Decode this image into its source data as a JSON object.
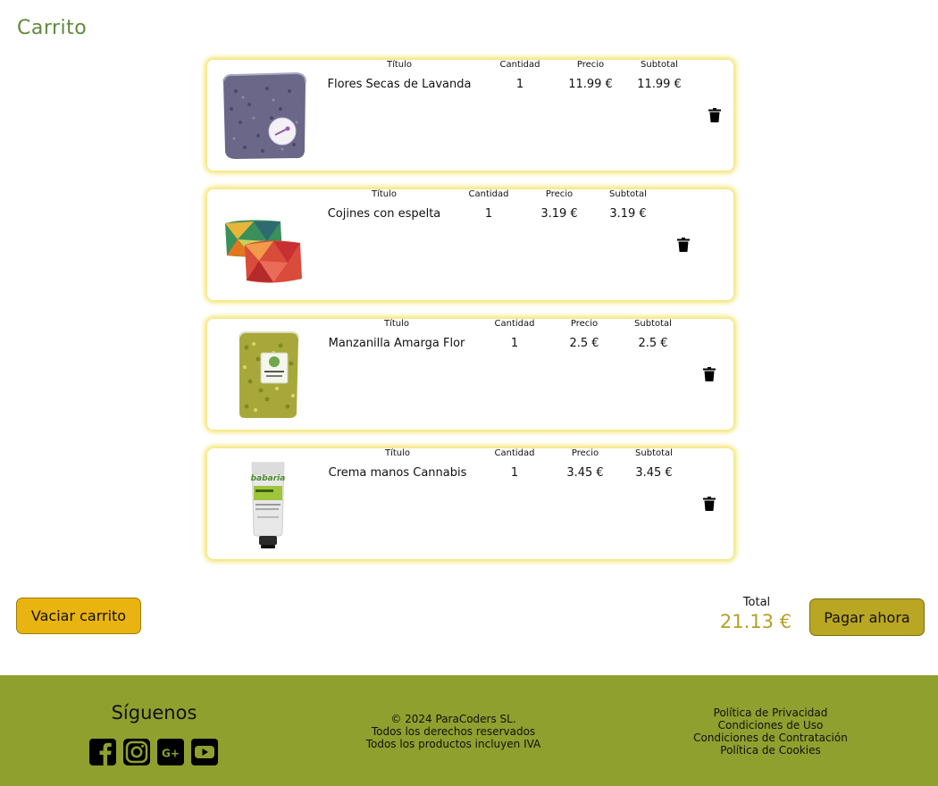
{
  "page": {
    "title": "Carrito"
  },
  "cart": {
    "headers": {
      "title": "Título",
      "quantity": "Cantidad",
      "price": "Precio",
      "subtotal": "Subtotal"
    },
    "items": [
      {
        "title": "Flores Secas de Lavanda",
        "quantity": "1",
        "price": "11.99 €",
        "subtotal": "11.99 €",
        "image": "lavender-bag"
      },
      {
        "title": "Cojines con espelta",
        "quantity": "1",
        "price": "3.19 €",
        "subtotal": "3.19 €",
        "image": "cushions"
      },
      {
        "title": "Manzanilla Amarga Flor",
        "quantity": "1",
        "price": "2.5 €",
        "subtotal": "2.5 €",
        "image": "chamomile-bag"
      },
      {
        "title": "Crema manos Cannabis",
        "quantity": "1",
        "price": "3.45 €",
        "subtotal": "3.45 €",
        "image": "hand-cream-tube"
      }
    ]
  },
  "summary": {
    "empty_cart_label": "Vaciar carrito",
    "total_label": "Total",
    "total_value": "21.13 €",
    "pay_label": "Pagar ahora"
  },
  "footer": {
    "follow_title": "Síguenos",
    "social": [
      "facebook-icon",
      "instagram-icon",
      "google-plus-icon",
      "youtube-icon"
    ],
    "copyright": "© 2024 ParaCoders SL.",
    "rights": "Todos los derechos reservados",
    "tax_note": "Todos los productos incluyen IVA",
    "links": [
      "Política de Privacidad",
      "Condiciones de Uso",
      "Condiciones de Contratación",
      "Política de Cookies"
    ]
  },
  "colors": {
    "title_green": "#5f8a3c",
    "card_glow": "#f3e36b",
    "empty_button": "#e9b40f",
    "pay_button": "#b9a623",
    "total_text": "#b79f27",
    "footer_bg": "#8fa02e"
  }
}
